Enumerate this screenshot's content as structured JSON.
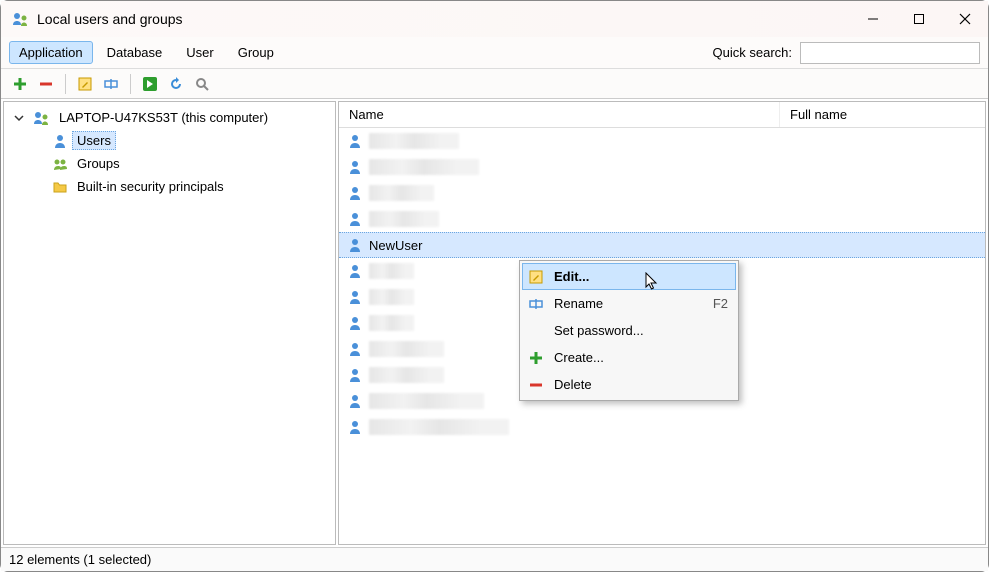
{
  "window": {
    "title": "Local users and groups"
  },
  "menus": {
    "application": "Application",
    "database": "Database",
    "user": "User",
    "group": "Group",
    "quick_search_label": "Quick search:",
    "quick_search_value": ""
  },
  "tree": {
    "root": "LAPTOP-U47KS53T (this computer)",
    "users": "Users",
    "groups": "Groups",
    "principals": "Built-in security principals"
  },
  "columns": {
    "name": "Name",
    "fullname": "Full name"
  },
  "users": {
    "selected": "NewUser"
  },
  "context_menu": {
    "edit": "Edit...",
    "rename": "Rename",
    "rename_shortcut": "F2",
    "set_password": "Set password...",
    "create": "Create...",
    "delete": "Delete"
  },
  "status": {
    "text": "12 elements  (1 selected)"
  }
}
